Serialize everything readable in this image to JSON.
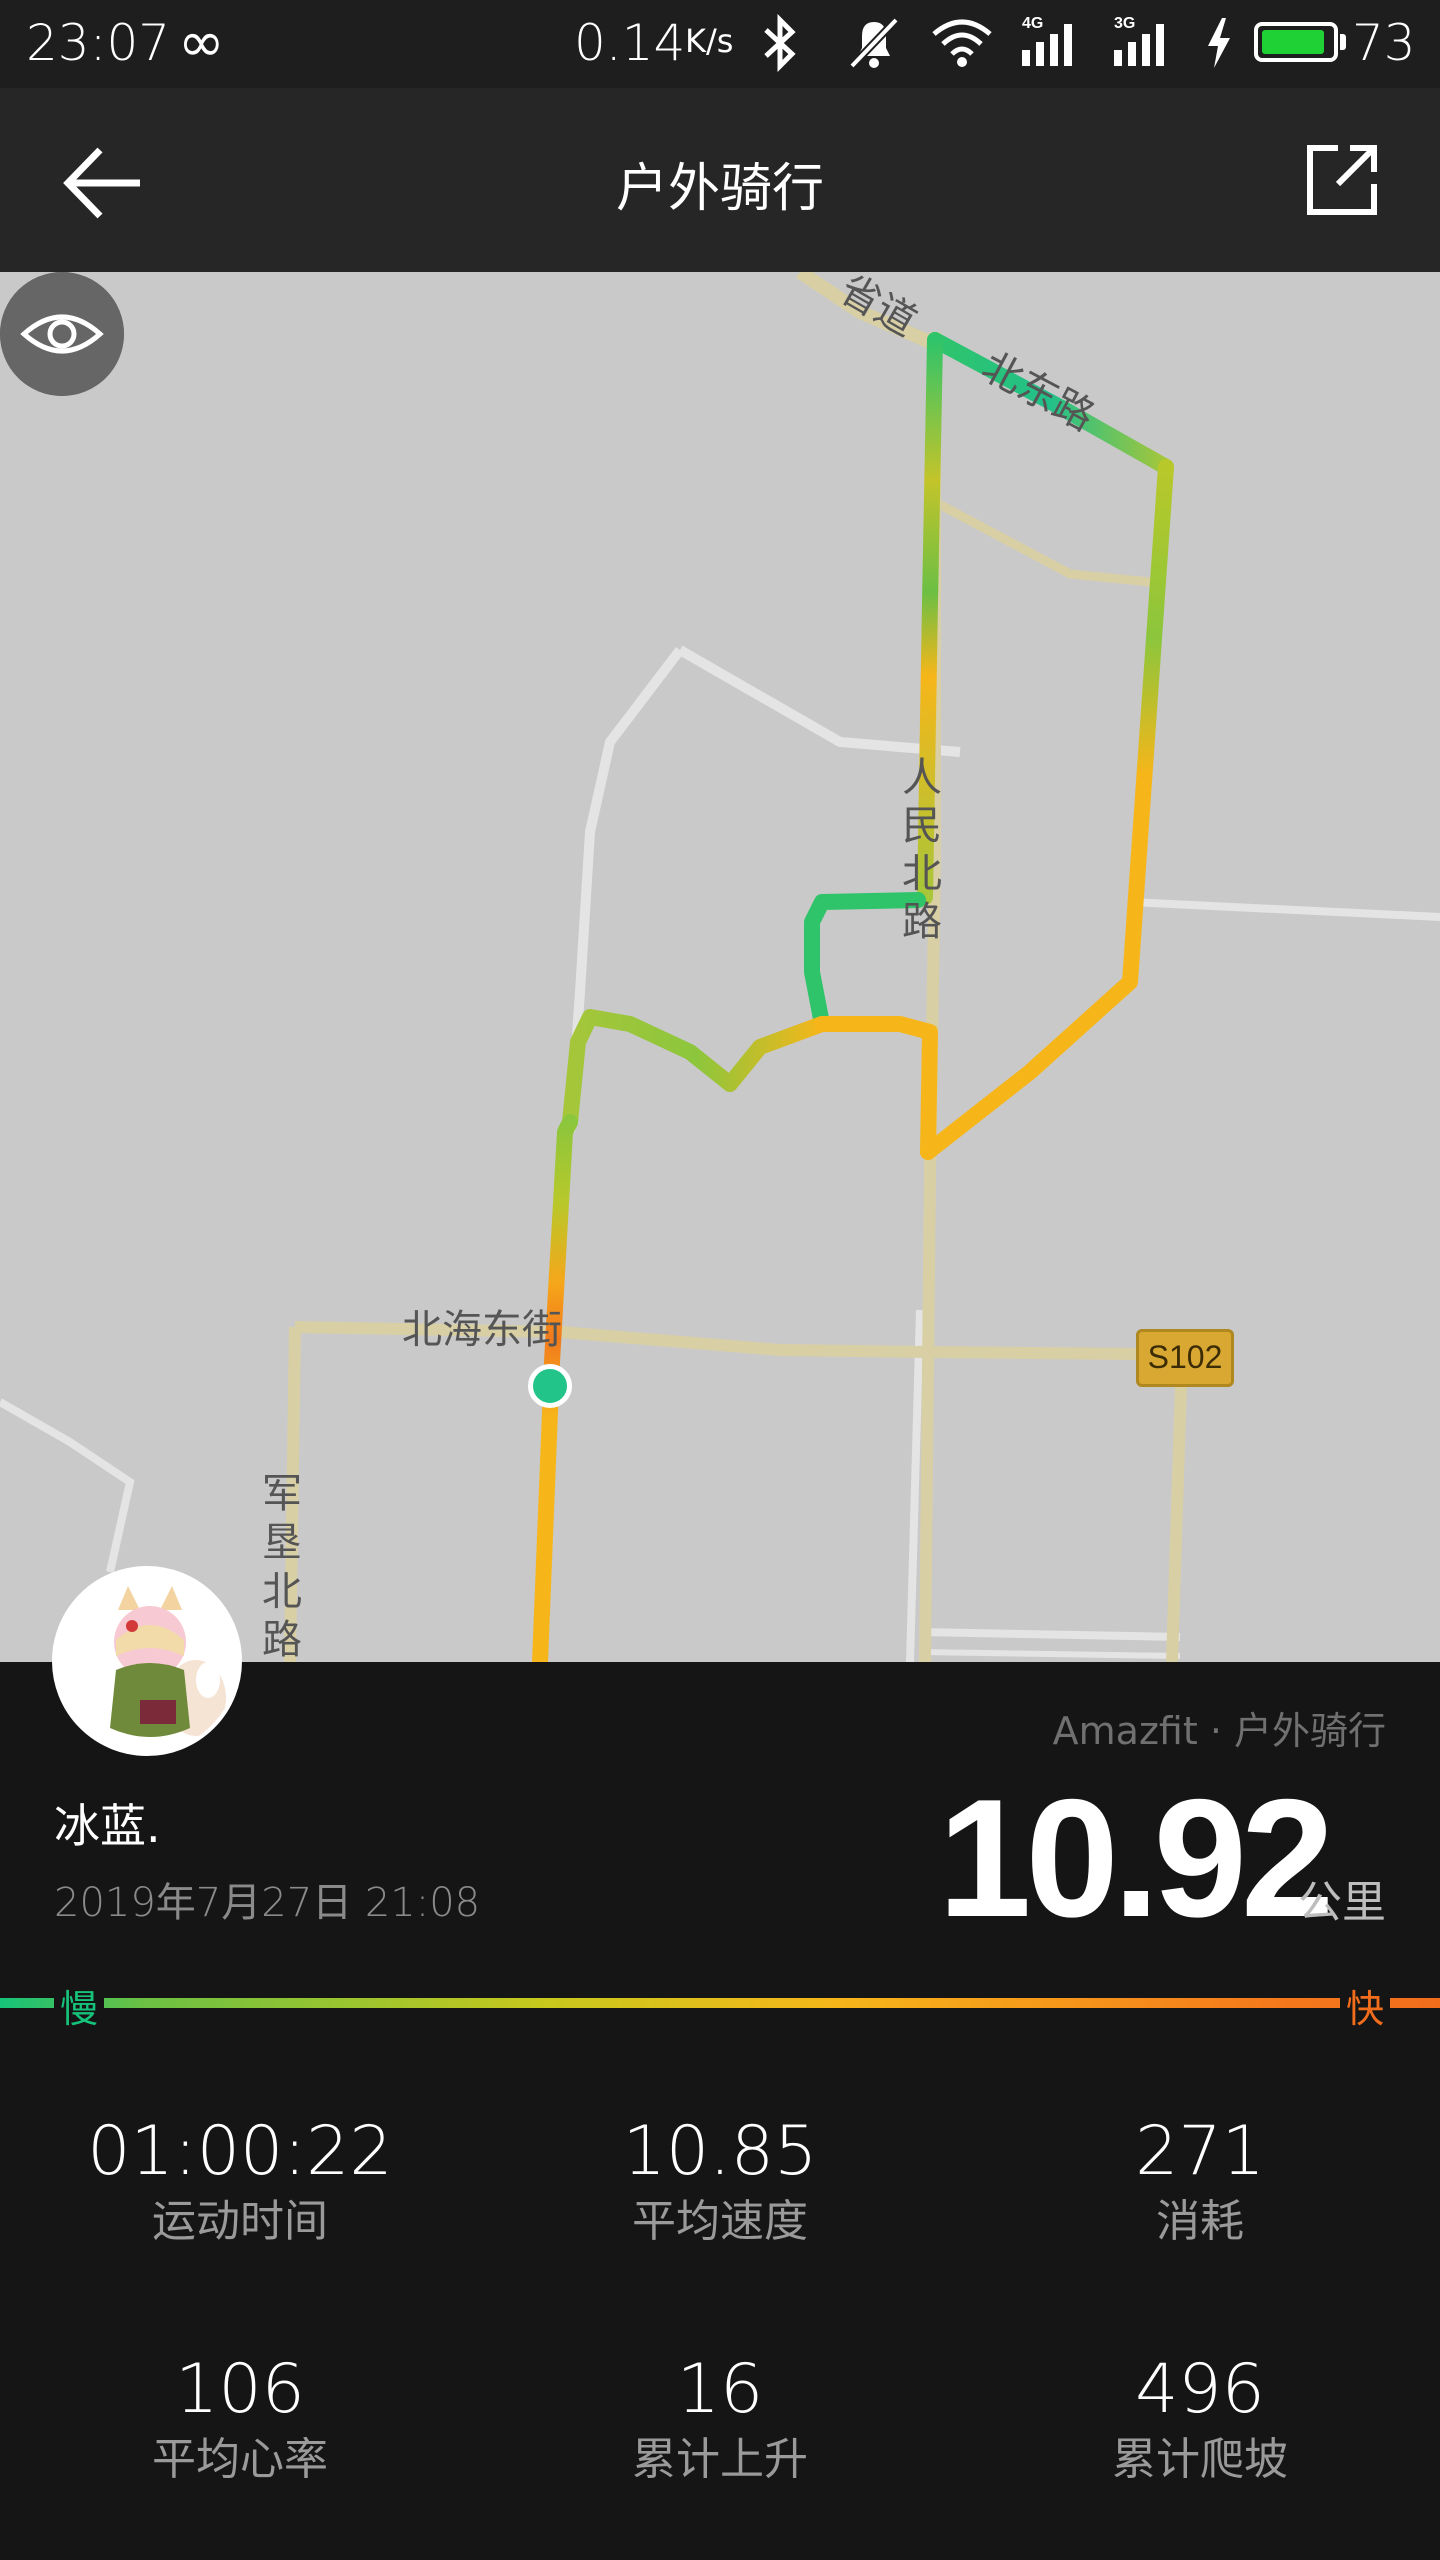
{
  "status_bar": {
    "time": "23:07",
    "infinity": "∞",
    "net_speed": "0.14",
    "net_speed_unit": "K/s",
    "battery": "73",
    "icons": [
      "bluetooth-icon",
      "mute-icon",
      "wifi-icon",
      "4g-signal-icon",
      "3g-signal-icon",
      "charging-icon",
      "battery-icon"
    ]
  },
  "header": {
    "title": "户外骑行",
    "back_icon": "back-arrow-icon",
    "share_icon": "share-icon"
  },
  "map": {
    "labels": {
      "provincial_road": "省道",
      "north_east_road": "北东路",
      "renmin_north_road": "人民北路",
      "beihai_east_street": "北海东街",
      "junken_north_road": "军垦北路"
    },
    "road_badge": "S102",
    "buttons": [
      "km-marker-toggle-icon",
      "eye-icon"
    ]
  },
  "summary": {
    "brand_line": "Amazfit · 户外骑行",
    "user_name": "冰蓝.",
    "date": "2019年7月27日  21:08",
    "distance": "10.92",
    "distance_unit": "公里",
    "speed_slow": "慢",
    "speed_fast": "快"
  },
  "stats": [
    {
      "value": "01:00:22",
      "label": "运动时间"
    },
    {
      "value": "10.85",
      "label": "平均速度"
    },
    {
      "value": "271",
      "label": "消耗"
    },
    {
      "value": "106",
      "label": "平均心率"
    },
    {
      "value": "16",
      "label": "累计上升"
    },
    {
      "value": "496",
      "label": "累计爬坡"
    }
  ],
  "colors": {
    "route_slow": "#16c37a",
    "route_mid": "#b8c82a",
    "route_fast": "#f6b61a",
    "route_fastest": "#f16d1c",
    "map_bg": "#c9c9c9",
    "road": "#d9cfa5",
    "panel_bg": "#151515",
    "header_bg": "#262626"
  }
}
